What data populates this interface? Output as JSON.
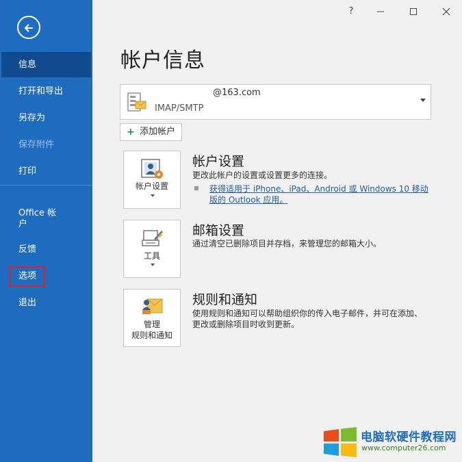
{
  "sidebar": {
    "items": [
      {
        "label": "信息"
      },
      {
        "label": "打开和导出"
      },
      {
        "label": "另存为"
      },
      {
        "label": "保存附件"
      },
      {
        "label": "打印"
      },
      {
        "label": "Office 帐户"
      },
      {
        "label": "反馈"
      },
      {
        "label": "选项"
      },
      {
        "label": "退出"
      }
    ]
  },
  "window": {
    "help": "?",
    "minimize": "—",
    "maximize": "☐",
    "close": "✕"
  },
  "main": {
    "title": "帐户信息",
    "account": {
      "email": "@163.com",
      "type": "IMAP/SMTP"
    },
    "add_account": "添加帐户",
    "sections": [
      {
        "tile_label": "帐户设置",
        "title": "帐户设置",
        "desc": "更改此帐户的设置或设置更多的连接。",
        "link": "获得适用于 iPhone、iPad、Android 或 Windows 10 移动版的 Outlook 应用。"
      },
      {
        "tile_label": "工具",
        "title": "邮箱设置",
        "desc": "通过清空已删除项目并存档，来管理您的邮箱大小。"
      },
      {
        "tile_label_1": "管理",
        "tile_label_2": "规则和通知",
        "title": "规则和通知",
        "desc": "使用规则和通知可以帮助组织你的传入电子邮件，并可在添加、更改或删除项目时收到更新。"
      }
    ]
  },
  "watermark": {
    "title": "电脑软硬件教程网",
    "url": "www.computer26.com"
  }
}
